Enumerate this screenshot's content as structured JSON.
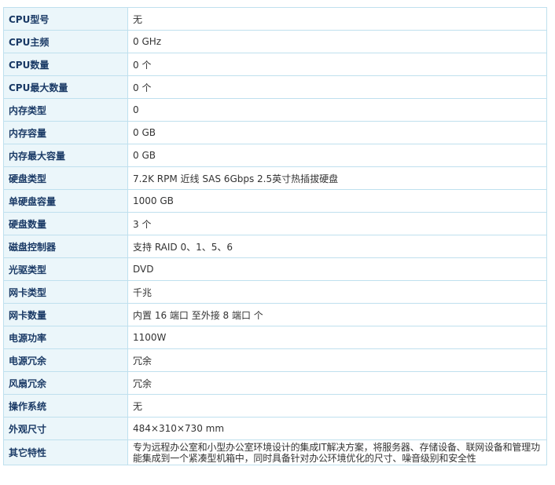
{
  "specs": [
    {
      "label": "CPU型号",
      "value": "无"
    },
    {
      "label": "CPU主频",
      "value": "0 GHz"
    },
    {
      "label": "CPU数量",
      "value": "0 个"
    },
    {
      "label": "CPU最大数量",
      "value": "0 个"
    },
    {
      "label": "内存类型",
      "value": "0"
    },
    {
      "label": "内存容量",
      "value": "0 GB"
    },
    {
      "label": "内存最大容量",
      "value": "0 GB"
    },
    {
      "label": "硬盘类型",
      "value": "7.2K RPM 近线 SAS 6Gbps 2.5英寸热插拔硬盘"
    },
    {
      "label": "单硬盘容量",
      "value": "1000 GB"
    },
    {
      "label": "硬盘数量",
      "value": "3 个"
    },
    {
      "label": "磁盘控制器",
      "value": "支持 RAID 0、1、5、6"
    },
    {
      "label": "光驱类型",
      "value": "DVD"
    },
    {
      "label": "网卡类型",
      "value": "千兆"
    },
    {
      "label": "网卡数量",
      "value": "内置 16 端口 至外接 8 端口 个"
    },
    {
      "label": "电源功率",
      "value": "1100W"
    },
    {
      "label": "电源冗余",
      "value": "冗余"
    },
    {
      "label": "风扇冗余",
      "value": "冗余"
    },
    {
      "label": "操作系统",
      "value": "无"
    },
    {
      "label": "外观尺寸",
      "value": "484×310×730 mm"
    },
    {
      "label": "其它特性",
      "value": "专为远程办公室和小型办公室环境设计的集成IT解决方案，将服务器、存储设备、联网设备和管理功能集成到一个紧凑型机箱中，同时具备针对办公环境优化的尺寸、噪音级别和安全性"
    }
  ]
}
